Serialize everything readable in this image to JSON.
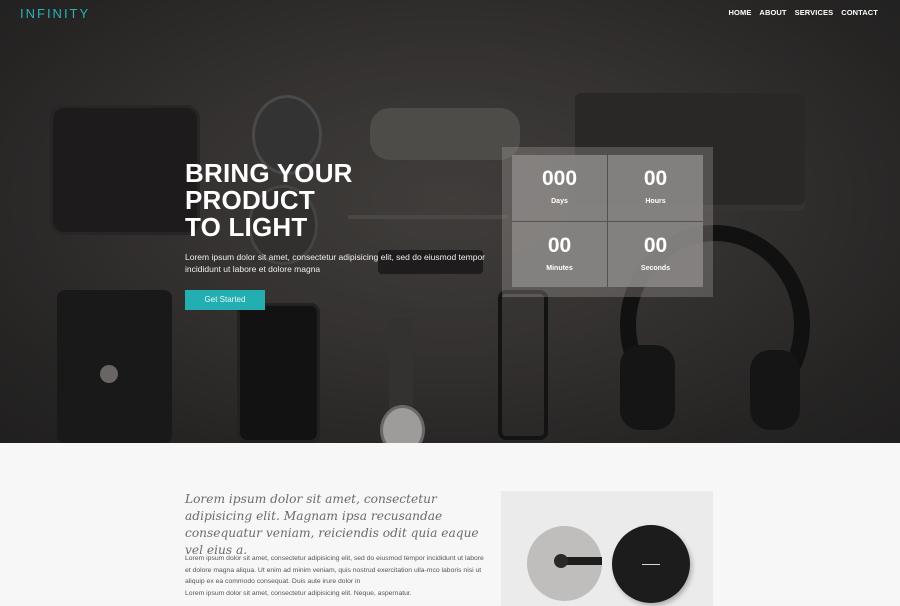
{
  "nav": {
    "logo": "INFINITY",
    "items": [
      {
        "label": "HOME"
      },
      {
        "label": "ABOUT"
      },
      {
        "label": "SERVICES"
      },
      {
        "label": "CONTACT"
      }
    ]
  },
  "hero": {
    "title_line1": "BRING YOUR PRODUCT",
    "title_line2": "TO LIGHT",
    "subtitle": "Lorem ipsum dolor sit amet, consectetur adipisicing elit, sed do eiusmod tempor incididunt ut labore et dolore magna",
    "cta_label": "Get Started",
    "accent_color": "#23aeb1"
  },
  "countdown": {
    "days": {
      "value": "000",
      "label": "Days"
    },
    "hours": {
      "value": "00",
      "label": "Hours"
    },
    "minutes": {
      "value": "00",
      "label": "Minutes"
    },
    "seconds": {
      "value": "00",
      "label": "Seconds"
    }
  },
  "about": {
    "quote": "Lorem ipsum dolor sit amet, consectetur adipisicing elit. Magnam ipsa recusandae consequatur veniam, reiciendis odit quia eaque vel eius a.",
    "body_line1": "Lorem ipsum dolor sit amet, consectetur adipisicing elit, sed do eiusmod tempor incididunt ut labore et dolore magna aliqua. Ut enim ad minim veniam, quis nostrud exercitation ulla-mco laboris nisi ut aliquip ex ea commodo consequat. Duis aute irure dolor in",
    "body_line2": "Lorem ipsum dolor sit amet, consectetur adipisicing elit. Neque, aspernatur."
  }
}
